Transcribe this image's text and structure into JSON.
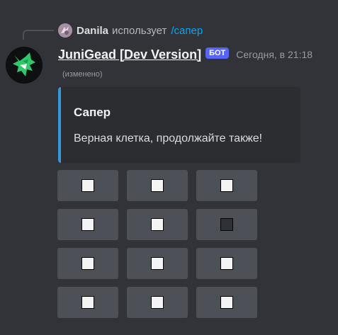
{
  "reply": {
    "user": "Danila",
    "verb": "использует",
    "command": "/сапер"
  },
  "message": {
    "author": "JuniGead [Dev Version]",
    "bot_tag": "БОТ",
    "timestamp": "Сегодня, в 21:18",
    "edited": "(изменено)"
  },
  "embed": {
    "accent_color": "#3498db",
    "title": "Сапер",
    "description": "Верная клетка, продолжайте также!"
  },
  "board": {
    "rows": [
      [
        "unrevealed",
        "unrevealed",
        "unrevealed"
      ],
      [
        "unrevealed",
        "unrevealed",
        "revealed"
      ],
      [
        "unrevealed",
        "unrevealed",
        "unrevealed"
      ],
      [
        "unrevealed",
        "unrevealed",
        "unrevealed"
      ]
    ]
  },
  "colors": {
    "background": "#313338",
    "bot_tag": "#5865f2",
    "command_link": "#00a8fc",
    "button": "#4e5058"
  }
}
